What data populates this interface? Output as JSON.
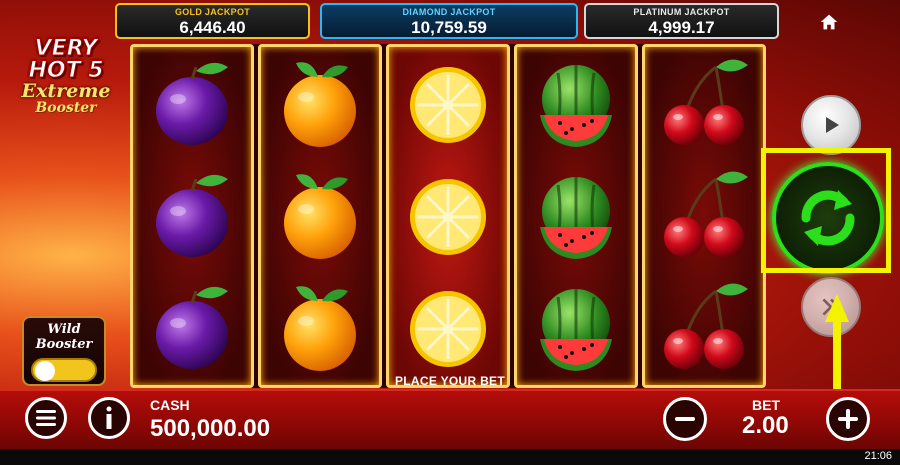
{
  "jackpots": {
    "gold": {
      "label": "GOLD JACKPOT",
      "value": "6,446.40"
    },
    "diamond": {
      "label": "DIAMOND JACKPOT",
      "value": "10,759.59"
    },
    "platinum": {
      "label": "PLATINUM JACKPOT",
      "value": "4,999.17"
    }
  },
  "logo": {
    "line1": "VERY",
    "line2": "HOT 5",
    "line3": "Extreme",
    "line4": "Booster"
  },
  "reels": [
    [
      "plum",
      "plum",
      "plum"
    ],
    [
      "orange",
      "orange",
      "orange"
    ],
    [
      "lemon",
      "lemon",
      "lemon"
    ],
    [
      "watermelon",
      "watermelon",
      "watermelon"
    ],
    [
      "cherry",
      "cherry",
      "cherry"
    ]
  ],
  "message": "PLACE YOUR BET",
  "wild_booster": {
    "line1": "Wild",
    "line2": "Booster",
    "enabled": false
  },
  "controls": {
    "home": "home-icon",
    "play": "play-icon",
    "spin": "spin-arrows-icon",
    "autoplay": "autoplay-icon",
    "highlight_color": "#f3f300",
    "spin_color": "#2be01a"
  },
  "bottom": {
    "cash_label": "CASH",
    "cash_value": "500,000.00",
    "bet_label": "BET",
    "bet_value": "2.00",
    "minus": "−",
    "plus": "+"
  },
  "status": {
    "clock": "21:06"
  }
}
